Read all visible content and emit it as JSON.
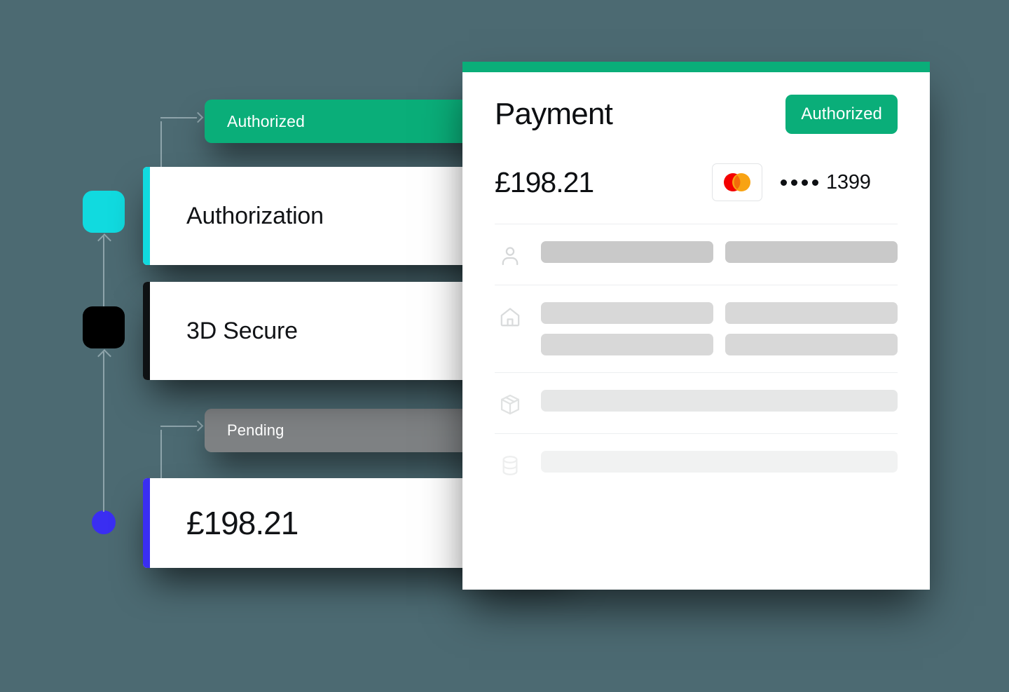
{
  "background_color": "#4c6a72",
  "timeline": {
    "markers": [
      {
        "name": "authorization-marker",
        "shape": "rounded-square",
        "color": "#11dadf"
      },
      {
        "name": "3dsecure-marker",
        "shape": "rounded-square",
        "color": "#000000"
      },
      {
        "name": "amount-marker",
        "shape": "circle",
        "color": "#3a2ef2"
      }
    ],
    "connector_color": "#8ea4ab"
  },
  "status_pills": [
    {
      "label": "Authorized",
      "color": "#0aae79"
    },
    {
      "label": "Pending",
      "color": "#7e8183"
    }
  ],
  "cards": [
    {
      "label": "Authorization",
      "accent": "#11dadf"
    },
    {
      "label": "3D Secure",
      "accent": "#0e1113"
    },
    {
      "label": "£198.21",
      "accent": "#3a2ef2"
    }
  ],
  "payment_panel": {
    "topbar_color": "#0aae79",
    "title": "Payment",
    "status_badge": "Authorized",
    "status_badge_color": "#0aae79",
    "amount": "£198.21",
    "card_brand_icon": "mastercard-icon",
    "card_mask_dots": "••••",
    "card_last4": "1399",
    "field_groups": [
      {
        "icon": "person-icon",
        "rows": 1,
        "columns": 2,
        "tone": "#c9c9c9"
      },
      {
        "icon": "home-icon",
        "rows": 2,
        "columns": 2,
        "tone": "#d8d8d8"
      },
      {
        "icon": "package-icon",
        "rows": 1,
        "columns": 1,
        "tone": "#e6e7e7"
      },
      {
        "icon": "database-icon",
        "rows": 1,
        "columns": 1,
        "tone": "#f1f2f2"
      }
    ]
  }
}
